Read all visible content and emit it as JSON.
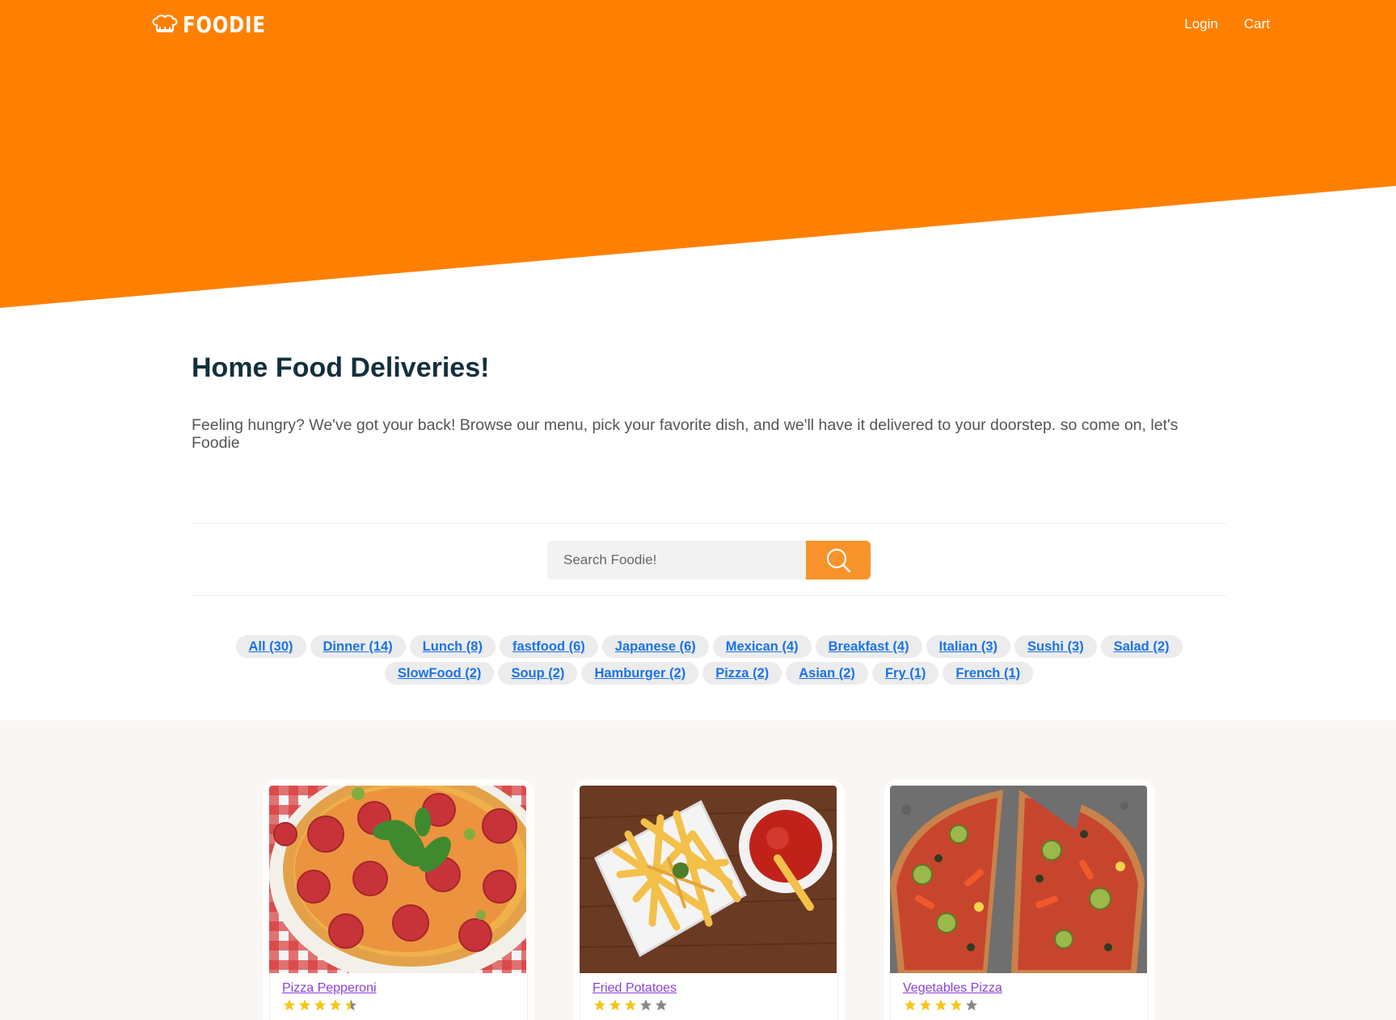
{
  "colors": {
    "brand": "#ff8000",
    "search_button": "#f7932a",
    "heading": "#12303d",
    "link": "#1a73e8",
    "food_link": "#8b3fd8",
    "star_on": "#f5c518",
    "star_off": "#888888"
  },
  "header": {
    "logo_text": "FOODIE",
    "logo_icon": "chef-hat-icon",
    "nav": {
      "login": "Login",
      "cart": "Cart"
    }
  },
  "intro": {
    "title": "Home Food Deliveries!",
    "description": "Feeling hungry? We've got your back! Browse our menu, pick your favorite dish, and we'll have it delivered to your doorstep. so come on, let's Foodie"
  },
  "search": {
    "placeholder": "Search Foodie!",
    "icon": "search-icon"
  },
  "tags": [
    [
      "All (30)",
      "Dinner (14)",
      "Lunch (8)",
      "fastfood (6)",
      "Japanese (6)",
      "Mexican (4)",
      "Breakfast (4)",
      "Italian (3)",
      "Sushi (3)",
      "Salad (2)"
    ],
    [
      "SlowFood (2)",
      "Soup (2)",
      "Hamburger (2)",
      "Pizza (2)",
      "Asian (2)",
      "Fry (1)",
      "French (1)"
    ]
  ],
  "foods": [
    {
      "name": "Pizza Pepperoni",
      "rating": 4.5,
      "image": "pepperoni-pizza-image"
    },
    {
      "name": "Fried Potatoes",
      "rating": 3,
      "image": "french-fries-image"
    },
    {
      "name": "Vegetables Pizza",
      "rating": 4,
      "image": "vegetable-pizza-image"
    }
  ]
}
